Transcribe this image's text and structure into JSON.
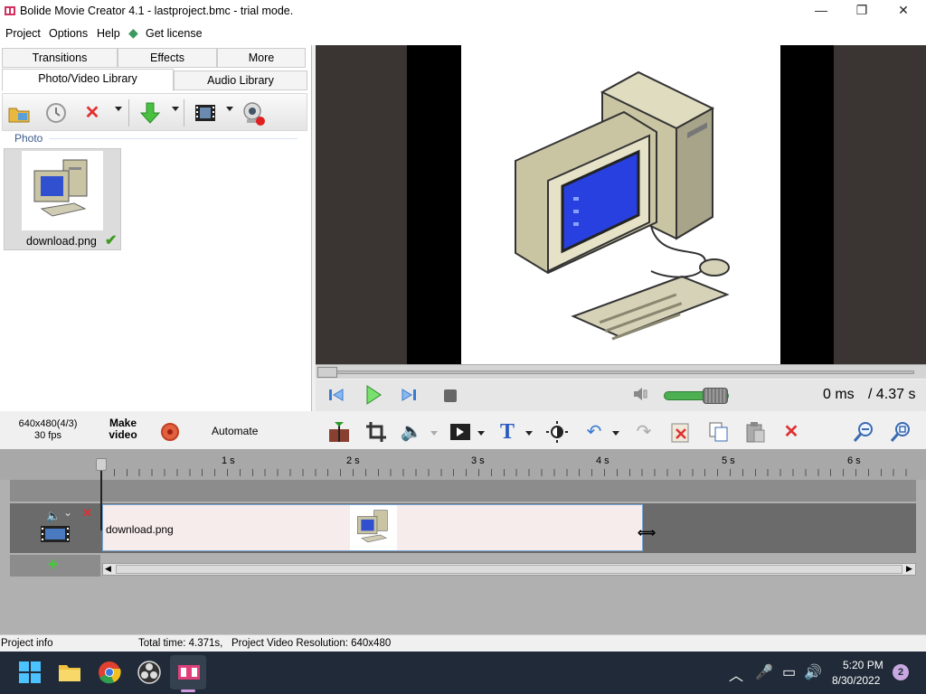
{
  "window": {
    "title": "Bolide Movie Creator 4.1 - lastproject.bmc  - trial mode.",
    "minimize": "—",
    "maximize": "❐",
    "close": "✕"
  },
  "menu": {
    "items": [
      "Project",
      "Options",
      "Help",
      "Get license"
    ]
  },
  "library": {
    "tabs_top": [
      "Transitions",
      "Effects",
      "More"
    ],
    "tabs_bottom": [
      "Photo/Video Library",
      "Audio Library"
    ],
    "active_tab": "Photo/Video Library",
    "section": "Photo",
    "items": [
      {
        "name": "download.png",
        "status": "✔"
      }
    ]
  },
  "preview": {
    "time_current": "0 ms",
    "time_total": "/ 4.37 s"
  },
  "toolbar": {
    "resolution": "640x480(4/3)",
    "fps": "30 fps",
    "make_video_line1": "Make",
    "make_video_line2": "video",
    "automate": "Automate"
  },
  "timeline": {
    "ruler_labels": [
      "1 s",
      "2 s",
      "3 s",
      "4 s",
      "5 s",
      "6 s"
    ],
    "clip_label": "download.png"
  },
  "status": {
    "project_info": "Project info",
    "total_time": "Total time: 4.371s,",
    "resolution": "Project Video Resolution:  640x480"
  },
  "taskbar": {
    "time": "5:20 PM",
    "date": "8/30/2022",
    "notifications": "2"
  },
  "colors": {
    "accent_blue": "#3a7ad0",
    "delete_red": "#e03030",
    "volume_green": "#4caf50",
    "taskbar": "#202a38"
  }
}
